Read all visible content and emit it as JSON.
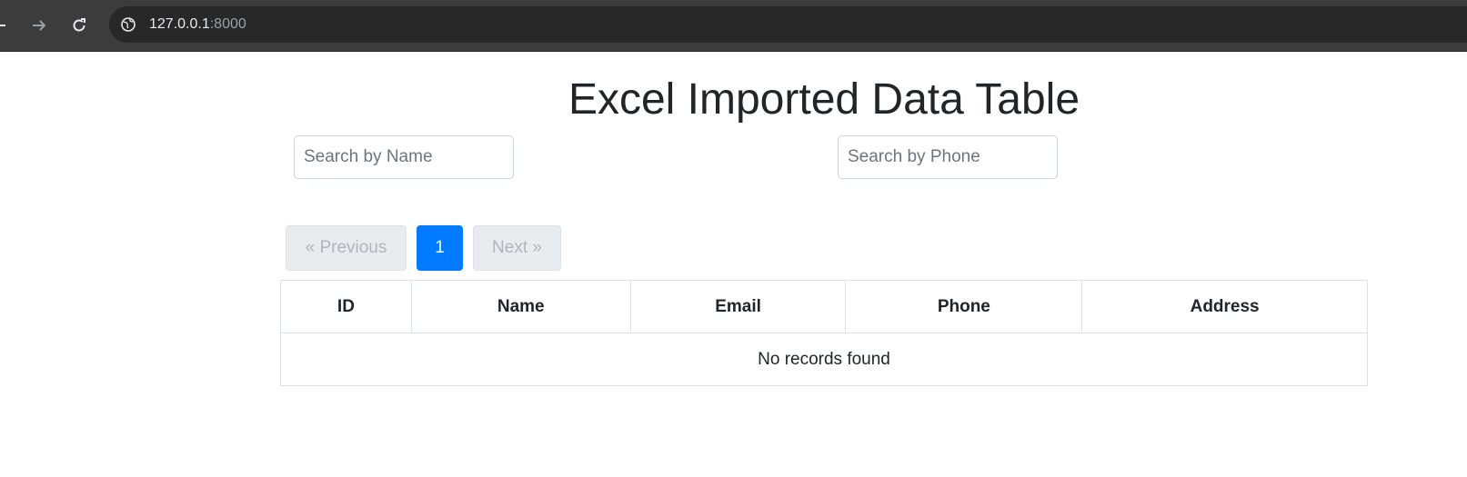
{
  "browser": {
    "url_host": "127.0.0.1",
    "url_port": ":8000",
    "icons": {
      "back": "arrow-left-icon",
      "forward": "arrow-right-icon",
      "reload": "reload-icon",
      "site_info": "globe-icon"
    }
  },
  "page": {
    "title": "Excel Imported Data Table",
    "search_name_placeholder": "Search by Name",
    "search_phone_placeholder": "Search by Phone"
  },
  "pagination": {
    "previous_label": "« Previous",
    "current_page": "1",
    "next_label": "Next »"
  },
  "table": {
    "columns": [
      "ID",
      "Name",
      "Email",
      "Phone",
      "Address"
    ],
    "empty_message": "No records found"
  },
  "colors": {
    "primary": "#007bff",
    "disabled_bg": "#e9ecef",
    "text": "#212529",
    "chrome": "#3c3c3c"
  }
}
